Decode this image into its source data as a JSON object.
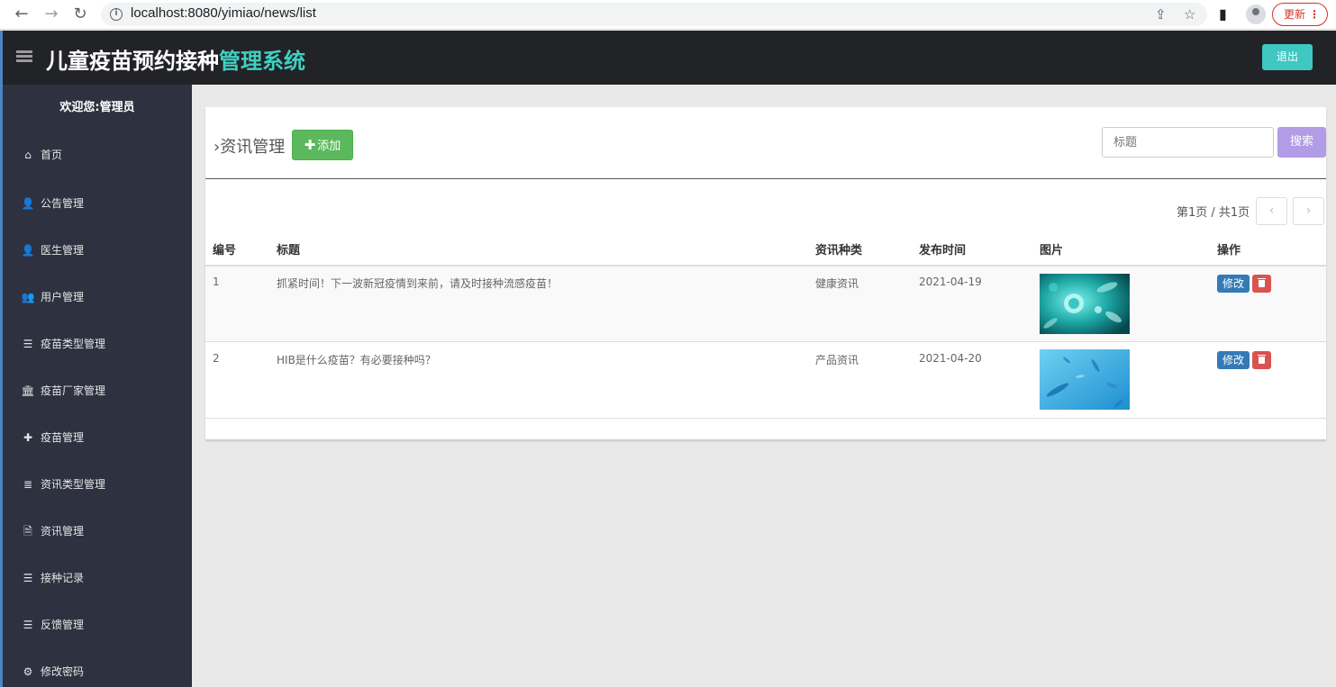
{
  "browser": {
    "back_icon": "←",
    "forward_icon": "→",
    "reload_icon": "↻",
    "url": "localhost:8080/yimiao/news/list",
    "share_icon": "⇪",
    "star_icon": "☆",
    "sidepanel_icon": "▮",
    "update_label": "更新",
    "menu_dots": "⋮"
  },
  "header": {
    "title_main": "儿童疫苗预约接种",
    "title_accent": "管理系统",
    "logout_label": "退出",
    "accent_color": "#3fd0c2"
  },
  "sidebar": {
    "welcome": "欢迎您:管理员",
    "items": [
      {
        "label": "首页",
        "icon": "⌂"
      },
      {
        "label": "公告管理",
        "icon": "👤"
      },
      {
        "label": "医生管理",
        "icon": "👤"
      },
      {
        "label": "用户管理",
        "icon": "👥"
      },
      {
        "label": "疫苗类型管理",
        "icon": "☰"
      },
      {
        "label": "疫苗厂家管理",
        "icon": "🏛"
      },
      {
        "label": "疫苗管理",
        "icon": "✚"
      },
      {
        "label": "资讯类型管理",
        "icon": "≣"
      },
      {
        "label": "资讯管理",
        "icon": "🗎"
      },
      {
        "label": "接种记录",
        "icon": "☰"
      },
      {
        "label": "反馈管理",
        "icon": "☰"
      },
      {
        "label": "修改密码",
        "icon": "⚙"
      }
    ]
  },
  "main": {
    "chevron": "›",
    "title": "资讯管理",
    "add_label": "添加",
    "add_plus": "✚",
    "search_placeholder": "标题",
    "search_label": "搜索",
    "pager_text": "第1页 / 共1页",
    "pager_prev": "‹",
    "pager_next": "›",
    "columns": [
      "编号",
      "标题",
      "资讯种类",
      "发布时间",
      "图片",
      "操作"
    ],
    "rows": [
      {
        "id": "1",
        "title": "抓紧时间！下一波新冠疫情到来前，请及时接种流感疫苗！",
        "category": "健康资讯",
        "date": "2021-04-19",
        "edit": "修改"
      },
      {
        "id": "2",
        "title": "HIB是什么疫苗？有必要接种吗？",
        "category": "产品资讯",
        "date": "2021-04-20",
        "edit": "修改"
      }
    ]
  }
}
